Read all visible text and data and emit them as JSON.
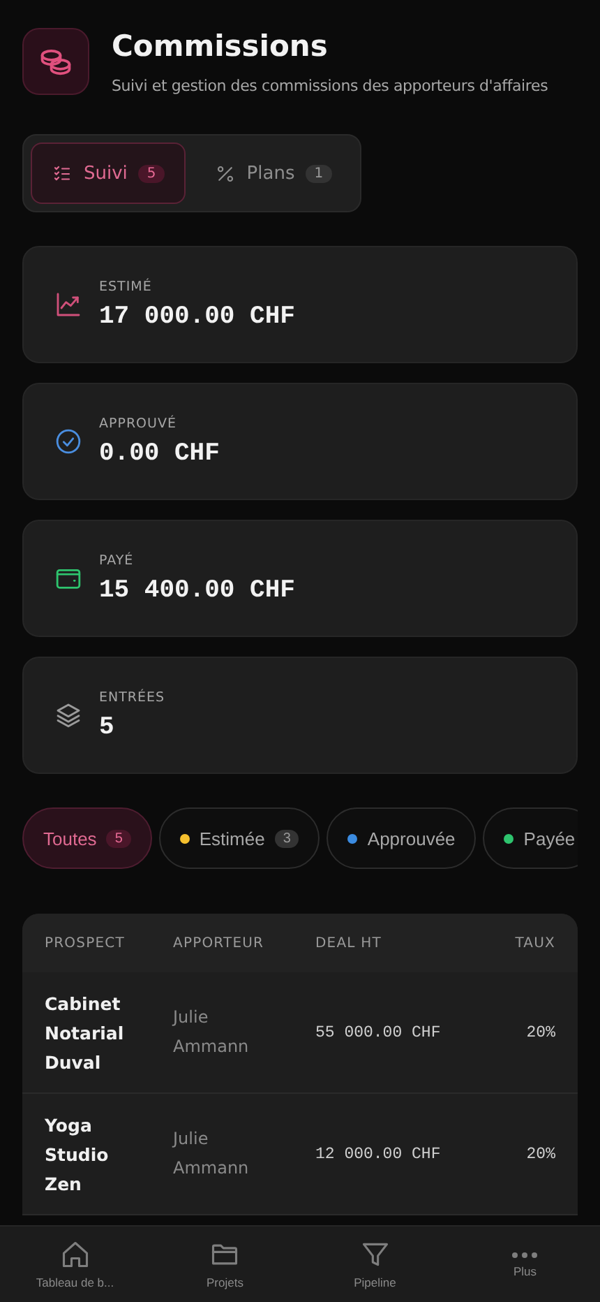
{
  "header": {
    "title": "Commissions",
    "subtitle": "Suivi et gestion des commissions des apporteurs d'affaires"
  },
  "tabs": [
    {
      "kind": "list",
      "label": "Suivi",
      "count": "5",
      "selected": true
    },
    {
      "kind": "percent",
      "label": "Plans",
      "count": "1",
      "selected": false
    }
  ],
  "stats": [
    {
      "kind": "trend",
      "label": "ESTIMÉ",
      "value": "17 000.00 CHF"
    },
    {
      "kind": "check",
      "label": "APPROUVÉ",
      "value": "0.00 CHF"
    },
    {
      "kind": "wallet",
      "label": "PAYÉ",
      "value": "15 400.00 CHF"
    },
    {
      "kind": "layers",
      "label": "ENTRÉES",
      "value": "5"
    }
  ],
  "filters": [
    {
      "label": "Toutes",
      "count": "5",
      "selected": true
    },
    {
      "label": "Estimée",
      "count": "3",
      "color": "#f5c02e",
      "selected": false
    },
    {
      "label": "Approuvée",
      "color": "#3b8be0",
      "selected": false
    },
    {
      "label": "Payée",
      "color": "#2ec46e",
      "selected": false
    }
  ],
  "table": {
    "columns": [
      "PROSPECT",
      "APPORTEUR",
      "DEAL HT",
      "TAUX"
    ],
    "rows": [
      {
        "prospect": "Cabinet Notarial Duval",
        "apporteur": "Julie Ammann",
        "deal": "55 000.00 CHF",
        "taux": "20%"
      },
      {
        "prospect": "Yoga Studio Zen",
        "apporteur": "Julie Ammann",
        "deal": "12 000.00 CHF",
        "taux": "20%"
      }
    ]
  },
  "nav": [
    {
      "kind": "home",
      "label": "Tableau de b..."
    },
    {
      "kind": "folder",
      "label": "Projets"
    },
    {
      "kind": "filter",
      "label": "Pipeline"
    },
    {
      "kind": "more",
      "label": "Plus"
    }
  ]
}
